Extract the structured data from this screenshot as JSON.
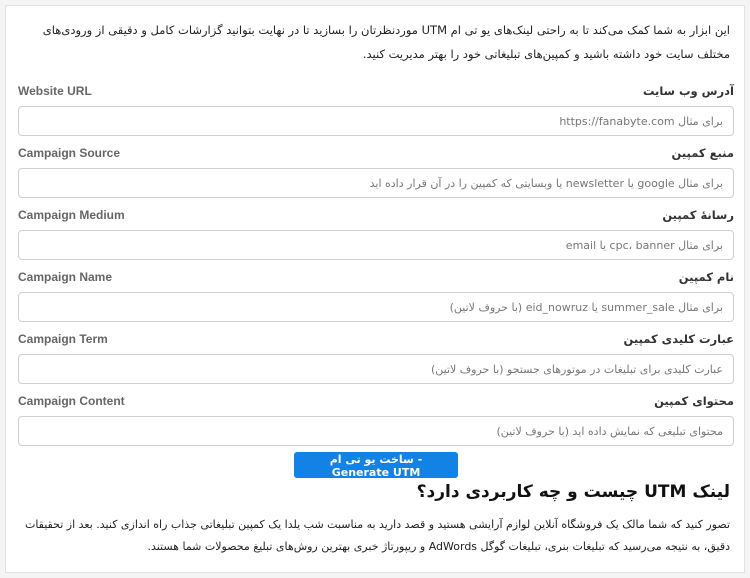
{
  "intro": "این ابزار به شما کمک می‌کند تا به راحتی لینک‌های یو تی ام UTM موردنظرتان را بسازید تا در نهایت بتوانید گزارشات کامل و دقیقی از ورودی‌های مختلف سایت خود داشته باشید و کمپین‌های تبلیغاتی خود را بهتر مدیریت کنید.",
  "fields": [
    {
      "label_en": "Website URL",
      "label_fa": "آدرس وب سایت",
      "placeholder": "برای مثال https://fanabyte.com"
    },
    {
      "label_en": "Campaign Source",
      "label_fa": "منبع کمپین",
      "placeholder": "برای مثال google یا newsletter یا وبسایتی که کمپین را در آن قرار داده اید"
    },
    {
      "label_en": "Campaign Medium",
      "label_fa": "رسانهٔ کمپین",
      "placeholder": "برای مثال cpc، banner یا email"
    },
    {
      "label_en": "Campaign Name",
      "label_fa": "نام کمپین",
      "placeholder": "برای مثال summer_sale یا eid_nowruz (با حروف لاتین)"
    },
    {
      "label_en": "Campaign Term",
      "label_fa": "عبارت کلیدی کمپین",
      "placeholder": "عبارت کلیدی برای تبلیغات در موتورهای جستجو (با حروف لاتین)"
    },
    {
      "label_en": "Campaign Content",
      "label_fa": "محتوای کمپین",
      "placeholder": "محتوای تبلیغی که نمایش داده اید (با حروف لاتین)"
    }
  ],
  "generate_button": "ساخت یو تی ام - Generate UTM",
  "section_heading": "لینک UTM چیست و چه کاربردی دارد؟",
  "section_paragraph": "تصور کنید که شما مالک یک فروشگاه آنلاین لوازم آرایشی هستید و قصد دارید به مناسبت شب یلدا یک کمپین تبلیغاتی جذاب راه اندازی کنید. بعد از تحقیقات دقیق، به نتیجه می‌رسید که تبلیغات بنری، تبلیغات گوگل AdWords و ریپورتاژ خبری بهترین روش‌های تبلیغ محصولات شما هستند.",
  "colors": {
    "button": "#1282e6",
    "label_en": "#666666",
    "border": "#cfcfcf"
  }
}
